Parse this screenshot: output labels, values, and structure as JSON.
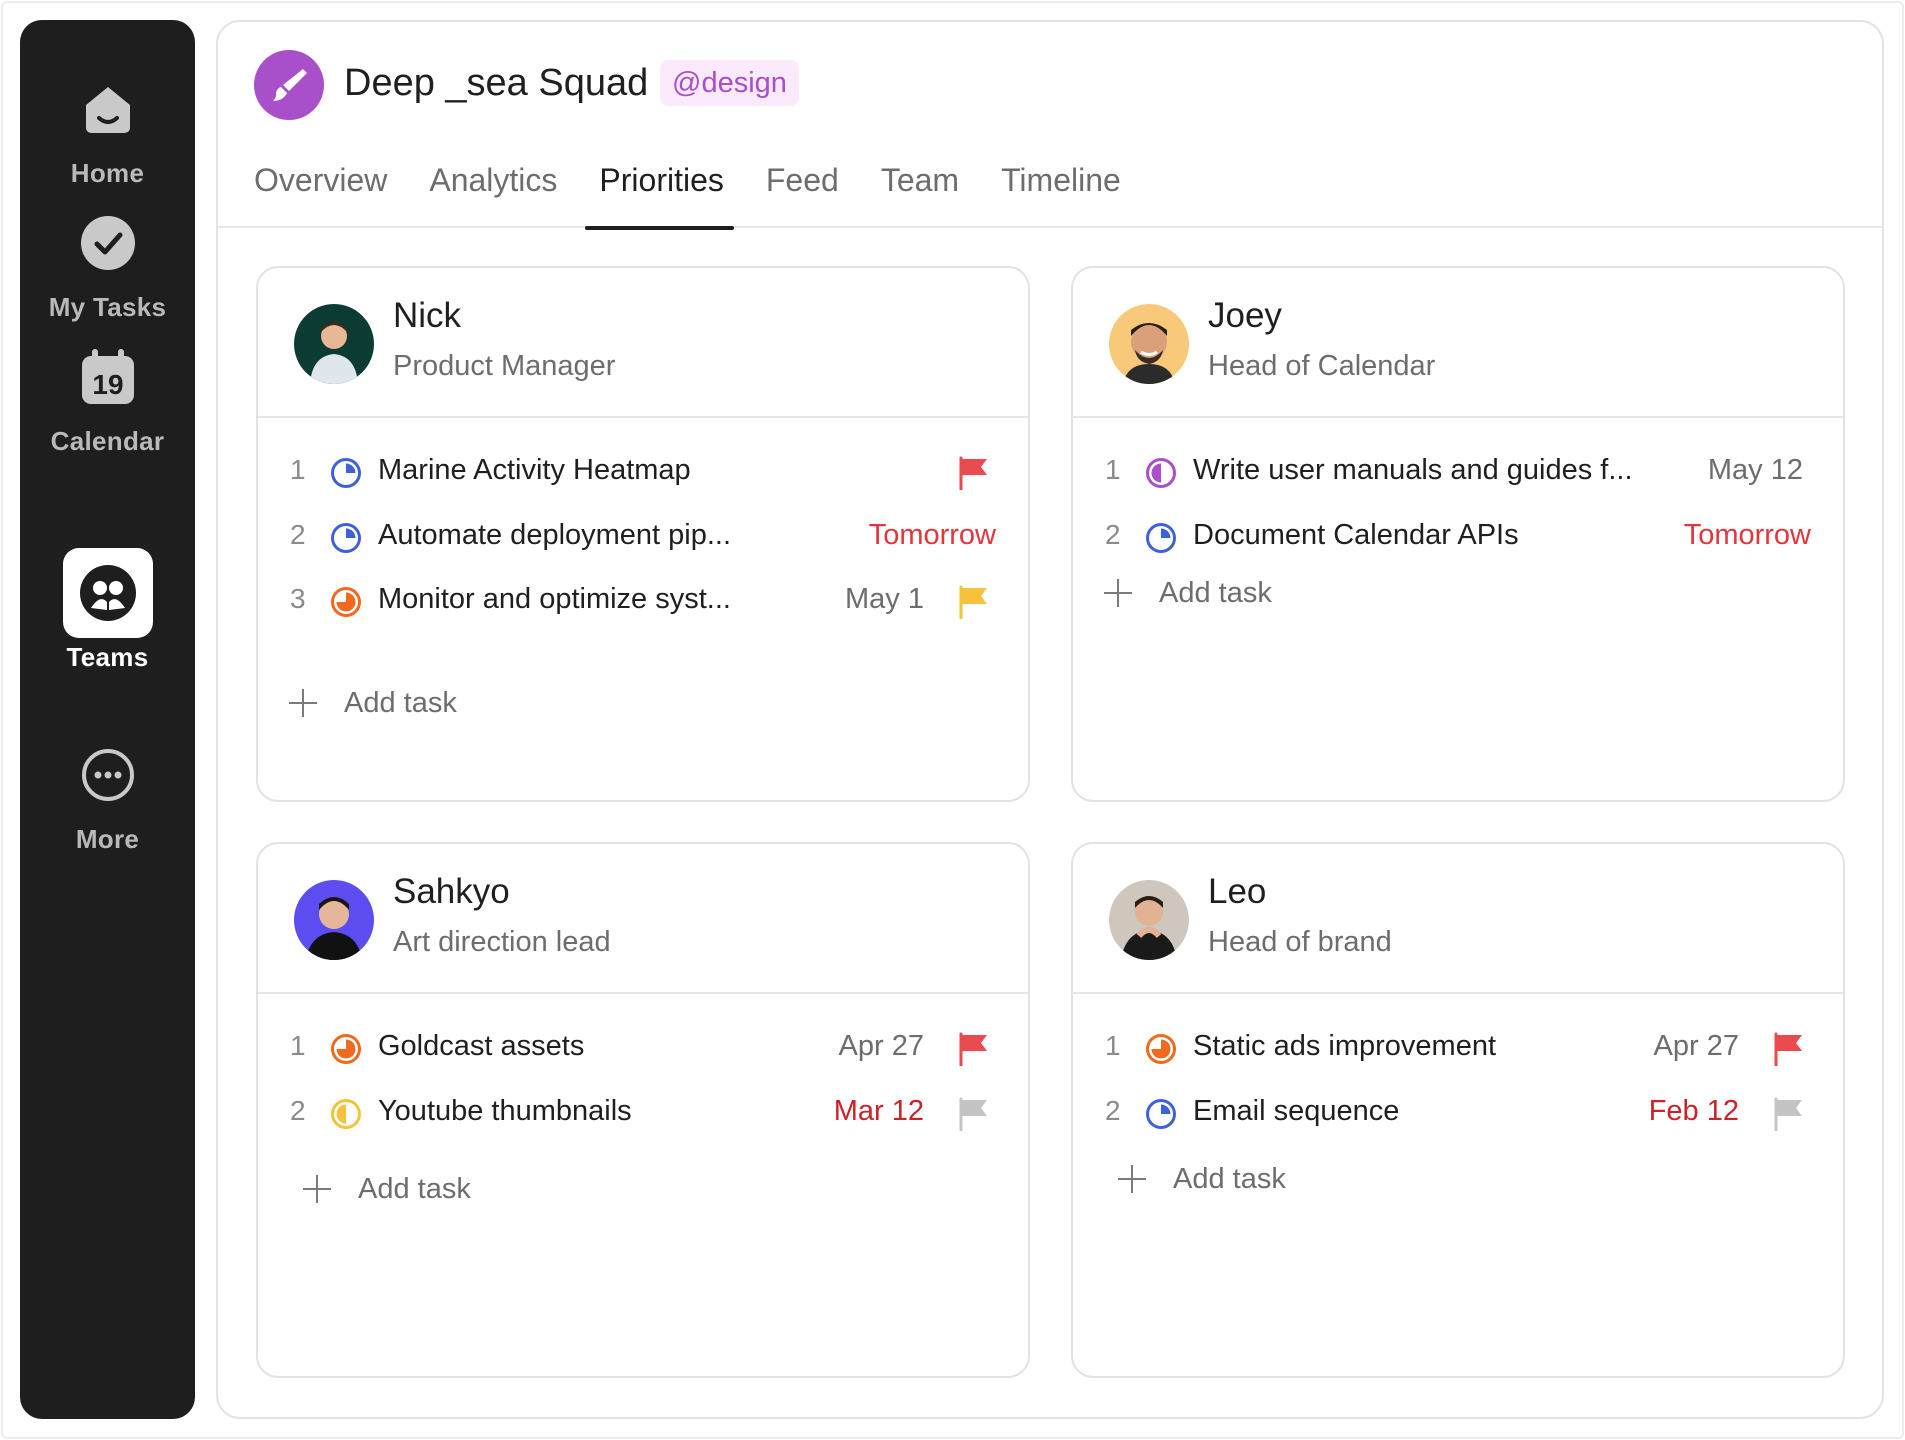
{
  "sidebar": {
    "items": [
      {
        "label": "Home",
        "icon": "home-icon"
      },
      {
        "label": "My Tasks",
        "icon": "check-circle-icon"
      },
      {
        "label": "Calendar",
        "icon": "calendar-icon",
        "badge": "19"
      },
      {
        "label": "Teams",
        "icon": "teams-icon",
        "active": true
      },
      {
        "label": "More",
        "icon": "more-icon"
      }
    ]
  },
  "header": {
    "team_name": "Deep _sea Squad",
    "handle": "@design",
    "logo_icon": "paintbrush-icon",
    "accent_color": "#a84fc9",
    "tabs": [
      {
        "label": "Overview"
      },
      {
        "label": "Analytics"
      },
      {
        "label": "Priorities",
        "active": true
      },
      {
        "label": "Feed"
      },
      {
        "label": "Team"
      },
      {
        "label": "Timeline"
      }
    ]
  },
  "members": [
    {
      "name": "Nick",
      "role": "Product Manager",
      "tasks": [
        {
          "num": "1",
          "title": "Marine Activity Heatmap",
          "due": "",
          "flag": "red",
          "status": "blue-quarter"
        },
        {
          "num": "2",
          "title": "Automate deployment pip...",
          "due": "Tomorrow",
          "flag": "",
          "status": "blue-quarter"
        },
        {
          "num": "3",
          "title": "Monitor and optimize syst...",
          "due": "May 1",
          "flag": "yellow",
          "status": "orange-three-quarter"
        }
      ],
      "add_label": "Add task"
    },
    {
      "name": "Joey",
      "role": "Head of Calendar",
      "tasks": [
        {
          "num": "1",
          "title": "Write user manuals and guides f...",
          "due": "May 12",
          "flag": "",
          "status": "purple-half"
        },
        {
          "num": "2",
          "title": "Document Calendar APIs",
          "due": "Tomorrow",
          "flag": "",
          "status": "blue-quarter"
        }
      ],
      "add_label": "Add task"
    },
    {
      "name": "Sahkyo",
      "role": "Art direction lead",
      "tasks": [
        {
          "num": "1",
          "title": "Goldcast assets",
          "due": "Apr 27",
          "flag": "red",
          "status": "orange-three-quarter"
        },
        {
          "num": "2",
          "title": "Youtube thumbnails",
          "due": "Mar 12",
          "flag": "gray",
          "status": "yellow-half"
        }
      ],
      "add_label": "Add task"
    },
    {
      "name": "Leo",
      "role": "Head of brand",
      "tasks": [
        {
          "num": "1",
          "title": "Static ads improvement",
          "due": "Apr 27",
          "flag": "red",
          "status": "orange-three-quarter"
        },
        {
          "num": "2",
          "title": "Email sequence",
          "due": "Feb 12",
          "flag": "gray",
          "status": "blue-quarter"
        }
      ],
      "add_label": "Add task"
    }
  ],
  "colors": {
    "flag_red": "#e84a4f",
    "flag_yellow": "#f5c33b",
    "flag_gray": "#c4c4c4",
    "due_overdue": "#c9232a",
    "due_tomorrow": "#e2363c",
    "status_blue": "#3e62d6",
    "status_orange": "#ee6a1f",
    "status_purple": "#a84fc9",
    "status_yellow": "#f5c33b"
  }
}
